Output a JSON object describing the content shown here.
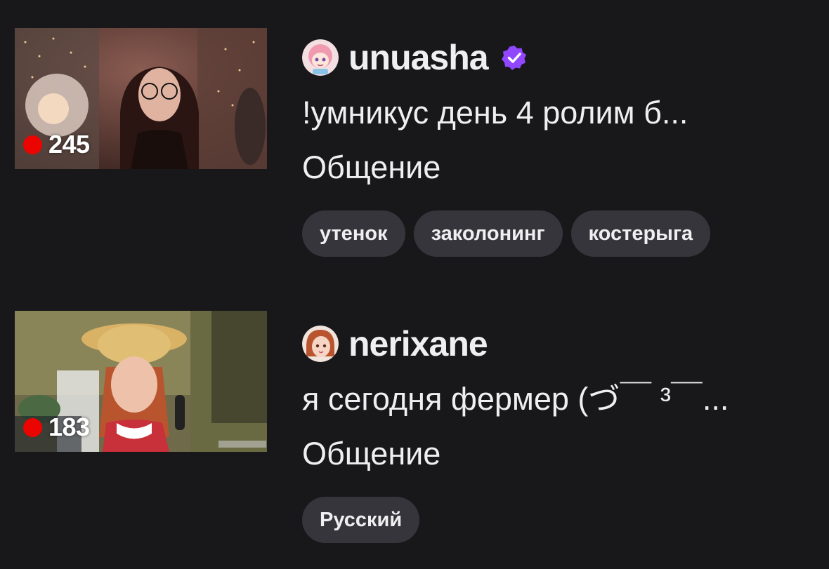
{
  "streams": [
    {
      "viewers": "245",
      "channel": "unuasha",
      "verified": true,
      "title": "!умникус день 4 ролим б...",
      "category": "Общение",
      "tags": [
        "утенок",
        "заколонинг",
        "костерыга"
      ]
    },
    {
      "viewers": "183",
      "channel": "nerixane",
      "verified": false,
      "title": "я сегодня фермер (づ￣ ³￣...",
      "category": "Общение",
      "tags": [
        "Русский"
      ]
    }
  ],
  "colors": {
    "background": "#18181b",
    "text": "#efeff1",
    "live": "#eb0400",
    "tag_bg": "#35353b",
    "verified": "#9147ff"
  }
}
